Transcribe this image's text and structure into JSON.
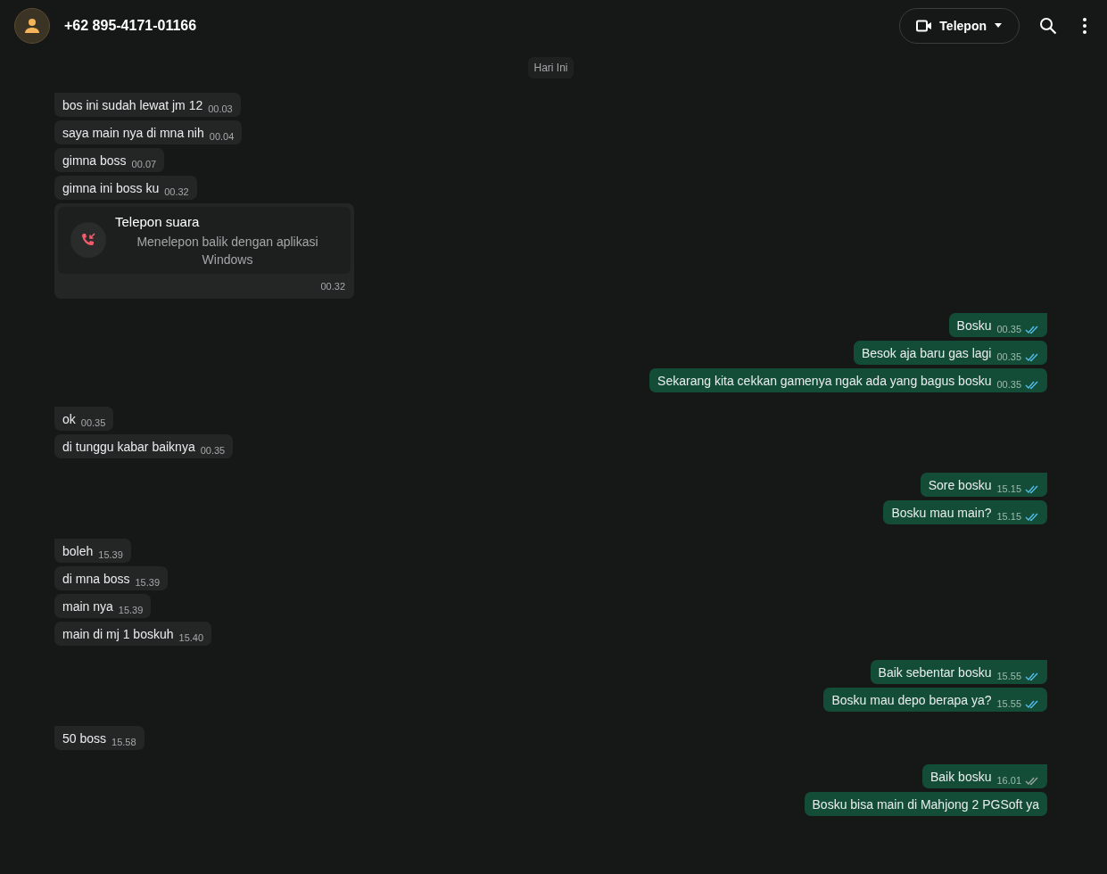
{
  "header": {
    "contact": "+62 895-4171-01166",
    "call_button": "Telepon"
  },
  "date_chip": "Hari Ini",
  "groups": [
    {
      "kind": "incoming",
      "messages": [
        {
          "kind": "text",
          "text": "bos ini sudah lewat jm 12",
          "time": "00.03"
        },
        {
          "kind": "text",
          "text": "saya main nya di mna nih",
          "time": "00.04"
        },
        {
          "kind": "text",
          "text": "gimna boss",
          "time": "00.07"
        },
        {
          "kind": "text",
          "text": "gimna ini boss ku",
          "time": "00.32"
        },
        {
          "kind": "call",
          "title": "Telepon suara",
          "subtitle": "Menelepon balik dengan aplikasi Windows",
          "time": "00.32"
        }
      ]
    },
    {
      "kind": "outgoing",
      "messages": [
        {
          "kind": "text",
          "text": "Bosku",
          "time": "00.35",
          "read": true
        },
        {
          "kind": "text",
          "text": "Besok aja baru gas lagi",
          "time": "00.35",
          "read": true
        },
        {
          "kind": "text",
          "text": "Sekarang kita cekkan gamenya ngak ada yang bagus bosku",
          "time": "00.35",
          "read": true
        }
      ]
    },
    {
      "kind": "incoming",
      "messages": [
        {
          "kind": "text",
          "text": "ok",
          "time": "00.35"
        },
        {
          "kind": "text",
          "text": "di tunggu kabar baiknya",
          "time": "00.35"
        }
      ]
    },
    {
      "kind": "outgoing",
      "messages": [
        {
          "kind": "text",
          "text": "Sore bosku",
          "time": "15.15",
          "read": true
        },
        {
          "kind": "text",
          "text": "Bosku mau main?",
          "time": "15.15",
          "read": true
        }
      ]
    },
    {
      "kind": "incoming",
      "messages": [
        {
          "kind": "text",
          "text": "boleh",
          "time": "15.39"
        },
        {
          "kind": "text",
          "text": "di mna boss",
          "time": "15.39"
        },
        {
          "kind": "text",
          "text": "main nya",
          "time": "15.39"
        },
        {
          "kind": "text",
          "text": "main di mj 1 boskuh",
          "time": "15.40"
        }
      ]
    },
    {
      "kind": "outgoing",
      "messages": [
        {
          "kind": "text",
          "text": "Baik sebentar bosku",
          "time": "15.55",
          "read": true
        },
        {
          "kind": "text",
          "text": "Bosku mau depo berapa ya?",
          "time": "15.55",
          "read": true
        }
      ]
    },
    {
      "kind": "incoming",
      "messages": [
        {
          "kind": "text",
          "text": "50 boss",
          "time": "15.58"
        }
      ]
    },
    {
      "kind": "outgoing",
      "messages": [
        {
          "kind": "text",
          "text": "Baik bosku",
          "time": "16.01",
          "read": false
        },
        {
          "kind": "text",
          "text": "Bosku bisa main di Mahjong 2 PGSoft ya"
        }
      ]
    }
  ]
}
